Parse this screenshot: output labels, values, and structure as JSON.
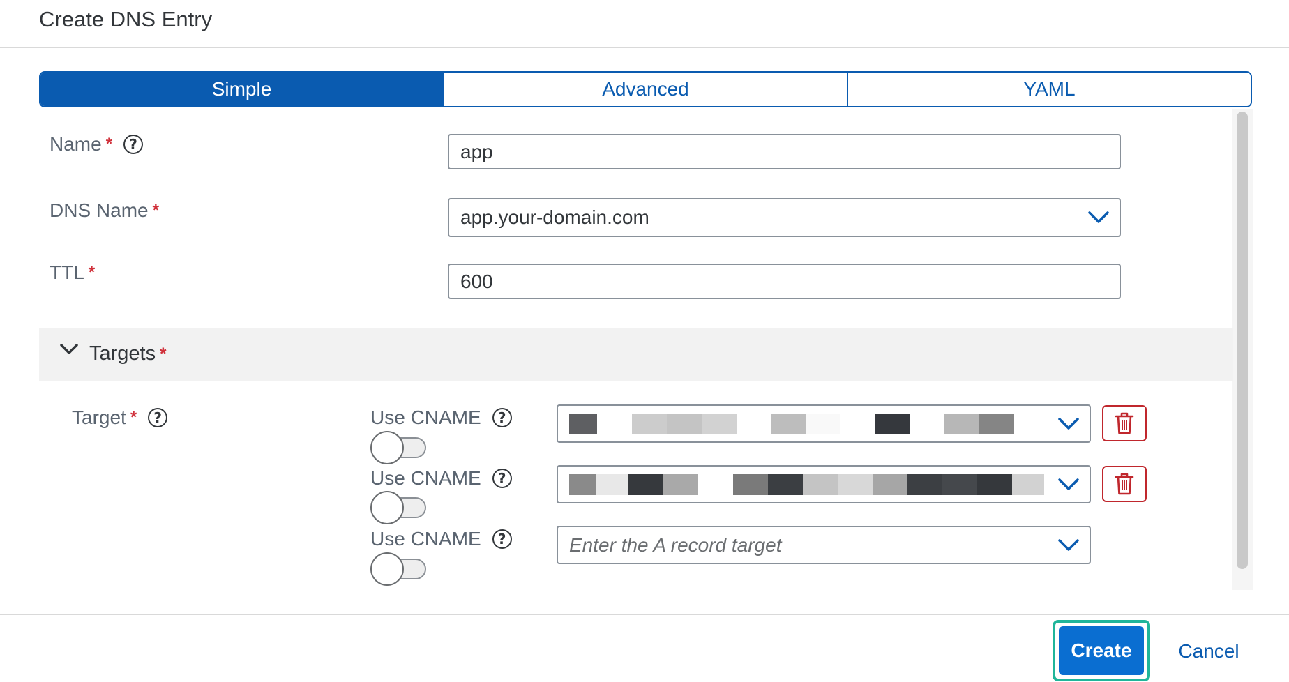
{
  "dialog": {
    "title": "Create DNS Entry"
  },
  "tabs": [
    {
      "label": "Simple",
      "active": true
    },
    {
      "label": "Advanced",
      "active": false
    },
    {
      "label": "YAML",
      "active": false
    }
  ],
  "fields": {
    "name": {
      "label": "Name",
      "value": "app"
    },
    "dns_name": {
      "label": "DNS Name",
      "value": "app.your-domain.com"
    },
    "ttl": {
      "label": "TTL",
      "value": "600"
    }
  },
  "required_marker": "*",
  "help_glyph": "?",
  "targets_section": {
    "title": "Targets",
    "expanded": true
  },
  "target": {
    "label": "Target",
    "rows": [
      {
        "cname_label": "Use CNAME",
        "cname_on": false,
        "value": "",
        "redacted": true,
        "placeholder": ""
      },
      {
        "cname_label": "Use CNAME",
        "cname_on": false,
        "value": "",
        "redacted": true,
        "placeholder": ""
      },
      {
        "cname_label": "Use CNAME",
        "cname_on": false,
        "value": "",
        "redacted": false,
        "placeholder": "Enter the A record target"
      }
    ]
  },
  "footer": {
    "create_label": "Create",
    "cancel_label": "Cancel"
  },
  "icons": {
    "help": "help-circle-icon",
    "chevron": "chevron-down-icon",
    "delete": "trash-icon"
  },
  "colors": {
    "accent": "#0a5bb0",
    "primary_button": "#0a6ed1",
    "required": "#d0303a",
    "delete": "#c0272d",
    "focus_ring": "#20b59a"
  }
}
